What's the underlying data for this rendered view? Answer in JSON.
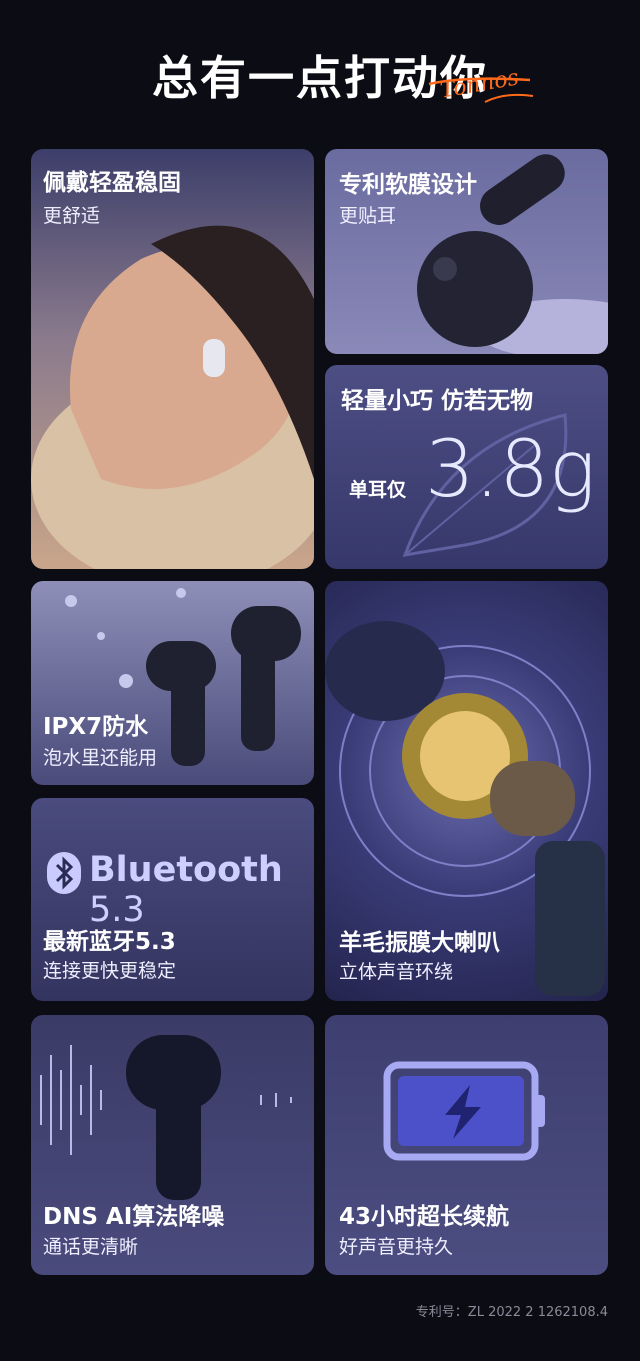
{
  "header": {
    "title": "总有一点打动你",
    "brand": "Tonnos"
  },
  "cards": {
    "comfort": {
      "title": "佩戴轻盈稳固",
      "sub": "更舒适"
    },
    "film": {
      "title": "专利软膜设计",
      "sub": "更贴耳"
    },
    "weight": {
      "title": "轻量小巧 仿若无物",
      "prefix": "单耳仅",
      "value": "3.8g"
    },
    "water": {
      "title": "IPX7防水",
      "sub": "泡水里还能用"
    },
    "speaker": {
      "title": "羊毛振膜大喇叭",
      "sub": "立体声音环绕"
    },
    "bt": {
      "logo_text": "Bluetooth",
      "logo_version": "5.3",
      "title": "最新蓝牙5.3",
      "sub": "连接更快更稳定"
    },
    "dns": {
      "title": "DNS AI算法降噪",
      "sub": "通话更清晰"
    },
    "battery": {
      "title": "43小时超长续航",
      "sub": "好声音更持久"
    }
  },
  "footnote": "专利号：ZL 2022 2 1262108.4",
  "colors": {
    "accent": "#ff6a1a",
    "card": "#4a4b7e",
    "background": "#0c0c14"
  },
  "icons": [
    "bluetooth-icon",
    "battery-icon",
    "lightning-icon",
    "leaf-icon"
  ]
}
